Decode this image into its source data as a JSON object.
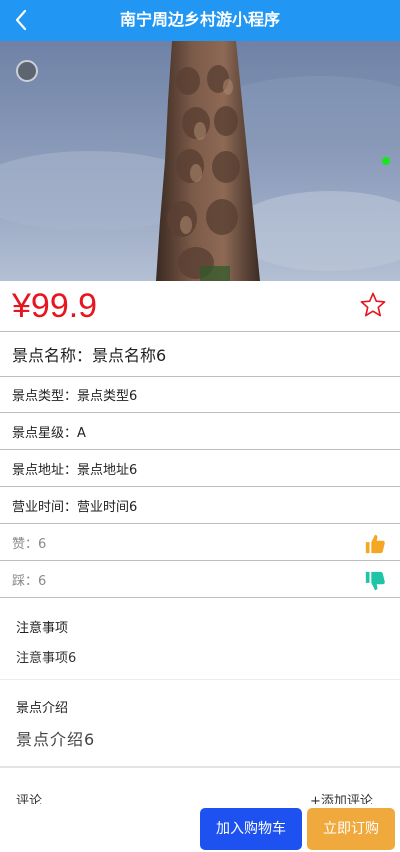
{
  "header": {
    "title": "南宁周边乡村游小程序"
  },
  "product": {
    "price": "¥99.9",
    "name_line": "景点名称：景点名称6",
    "type_line": "景点类型：景点类型6",
    "level_line": "景点星级：A",
    "address_line": "景点地址：景点地址6",
    "hours_line": "营业时间：营业时间6",
    "likes_line": "赞：6",
    "dislikes_line": "踩：6"
  },
  "notice": {
    "title": "注意事项",
    "body": "注意事项6"
  },
  "intro": {
    "title": "景点介绍",
    "body": "景点介绍6"
  },
  "comments": {
    "title": "评论",
    "add_label": "+添加评论"
  },
  "actions": {
    "cart_label": "加入购物车",
    "order_label": "立即订购"
  },
  "colors": {
    "header_bg": "#2196f3",
    "price": "#e8141e",
    "like_icon": "#f5a623",
    "dislike_icon": "#1fc4a7",
    "cart_button": "#1e52f0",
    "order_button": "#f0a93c"
  },
  "icons": [
    "back-icon",
    "star-icon",
    "thumbs-up-icon",
    "thumbs-down-icon"
  ]
}
